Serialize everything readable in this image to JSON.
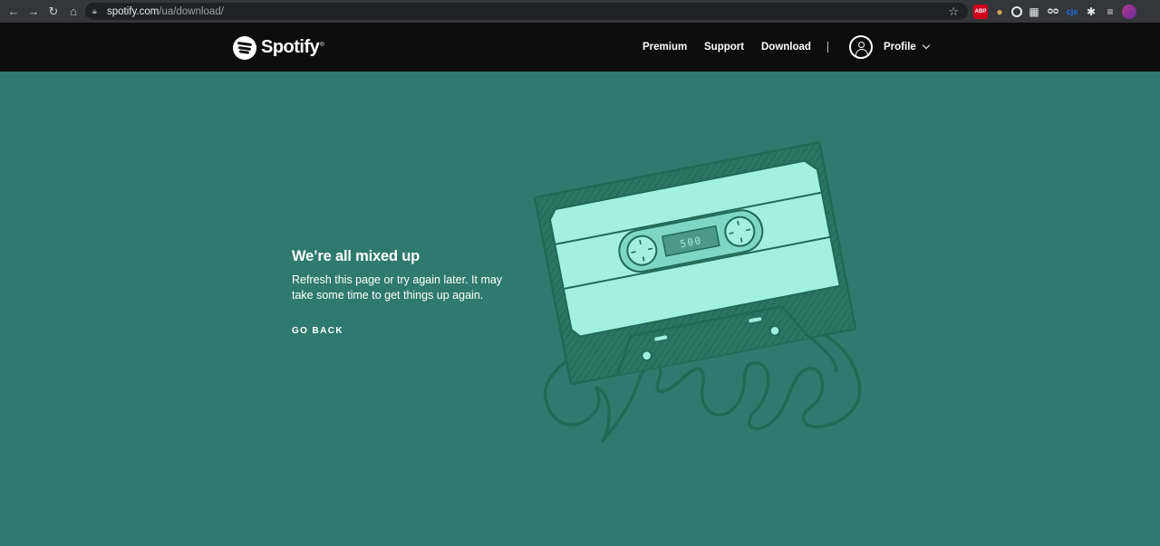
{
  "browser": {
    "url_host": "spotify.com",
    "url_path": "/ua/download/",
    "extensions": {
      "abp_badge": "ABP",
      "abp_count": "2",
      "cjs_label": "cjs"
    }
  },
  "header": {
    "brand": "Spotify",
    "nav": {
      "premium": "Premium",
      "support": "Support",
      "download": "Download"
    },
    "profile_label": "Profile"
  },
  "error": {
    "title": "We’re all mixed up",
    "message": "Refresh this page or try again later. It may take some time to get things up again.",
    "go_back": "GO BACK"
  },
  "cassette": {
    "counter": "500"
  },
  "colors": {
    "page_bg": "#2e7a6e",
    "header_bg": "#0d0d0d",
    "cassette_light": "#a2f0de",
    "cassette_dark": "#1f6a55"
  }
}
